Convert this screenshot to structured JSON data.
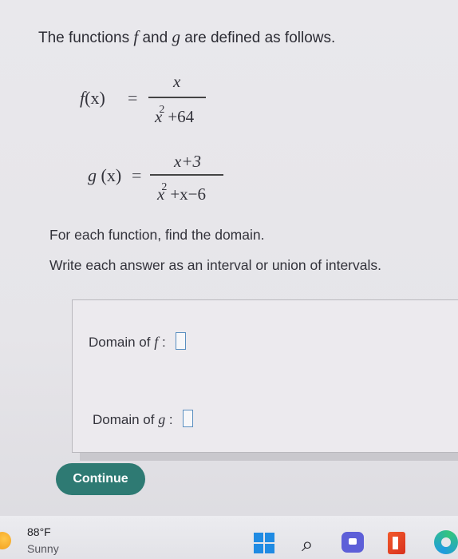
{
  "problem": {
    "intro_prefix": "The functions ",
    "f_name": "f",
    "and_word": " and ",
    "g_name": "g",
    "intro_suffix": " are defined as follows."
  },
  "f_def": {
    "lhs_fn": "f",
    "lhs_arg": "(x)",
    "equals": "=",
    "numerator": "x",
    "den_base": "x",
    "den_exp": "2",
    "den_rest": "+64"
  },
  "g_def": {
    "lhs_fn": "g",
    "lhs_arg": " (x)",
    "equals": "=",
    "numerator": "x+3",
    "den_base": "x",
    "den_exp": "2",
    "den_rest": "+x−6"
  },
  "instructions": {
    "line1": "For each function, find the domain.",
    "line2": "Write each answer as an interval or union of intervals."
  },
  "answers": {
    "f_label_prefix": "Domain of ",
    "f_label_var": "f",
    "f_label_suffix": " :",
    "g_label_prefix": "Domain of ",
    "g_label_var": "g",
    "g_label_suffix": " :"
  },
  "continue_label": "Continue",
  "taskbar": {
    "temperature": "88°F",
    "condition": "Sunny"
  },
  "colors": {
    "accent": "#2e7a73",
    "input_border": "#5a8fc0",
    "windows_blue": "#1f8be3"
  },
  "icons": [
    "weather-sun-icon",
    "windows-start-icon",
    "search-icon",
    "chat-icon",
    "office-icon",
    "edge-icon"
  ]
}
